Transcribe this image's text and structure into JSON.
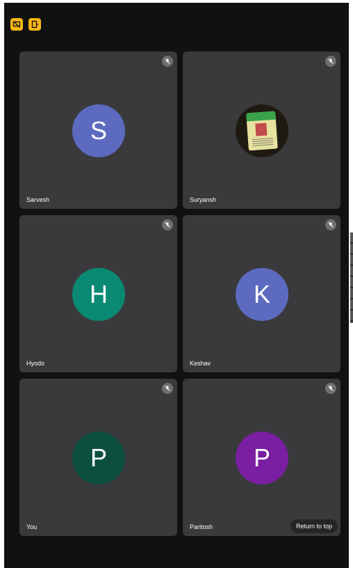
{
  "top_icons": [
    {
      "icon": "screen-share-off-icon"
    },
    {
      "icon": "exit-door-icon"
    }
  ],
  "colors": {
    "background": "#111111",
    "tile": "#3a3a3c",
    "accent": "#f6b614"
  },
  "tiles": [
    {
      "name": "Sarvesh",
      "initial": "S",
      "avatar_color": "#5c6bc0",
      "muted": true
    },
    {
      "name": "Suryansh",
      "initial": "",
      "avatar_color": "#1e1a12",
      "muted": true,
      "photo": true
    },
    {
      "name": "Hyodo",
      "initial": "H",
      "avatar_color": "#0b8a73",
      "muted": true
    },
    {
      "name": "Keshav",
      "initial": "K",
      "avatar_color": "#5c6bc0",
      "muted": true
    },
    {
      "name": "You",
      "initial": "P",
      "avatar_color": "#0d4f3d",
      "muted": true
    },
    {
      "name": "Paritosh",
      "initial": "P",
      "avatar_color": "#7b1fa2",
      "muted": true
    }
  ],
  "return_to_top_label": "Return to top"
}
